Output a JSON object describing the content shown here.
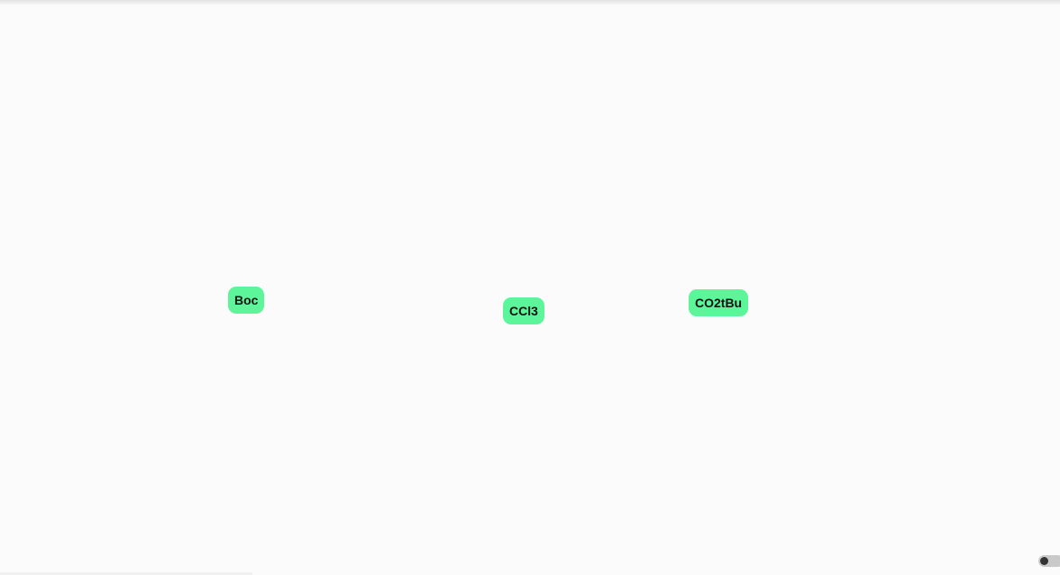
{
  "graph": {
    "nodes": [
      {
        "id": "boc",
        "label": "Boc"
      },
      {
        "id": "ccl3",
        "label": "CCl3"
      },
      {
        "id": "co2tbu",
        "label": "CO2tBu"
      }
    ]
  },
  "colors": {
    "background": "#fbfbfb",
    "node_fill": "#5cf59a",
    "node_text": "#111111"
  },
  "toggle": {
    "state": "off"
  }
}
